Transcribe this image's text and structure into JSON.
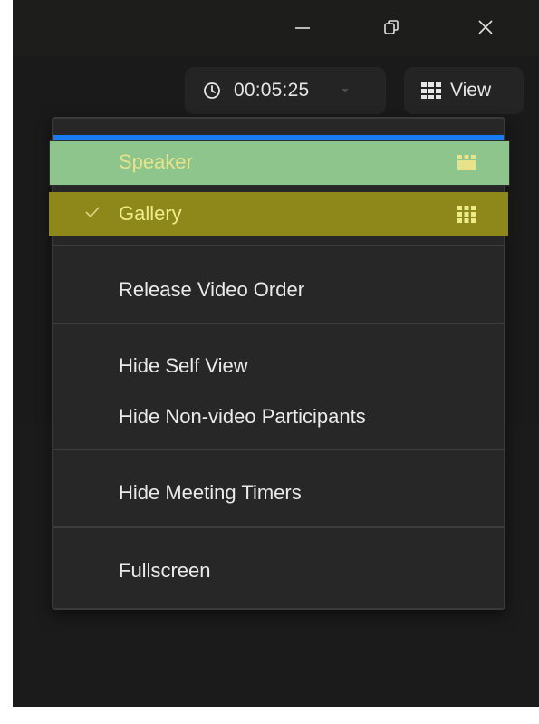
{
  "window": {
    "controls": {
      "minimize_icon": "minimize-icon",
      "restore_icon": "restore-icon",
      "close_icon": "close-icon"
    }
  },
  "toolbar": {
    "timer": {
      "icon": "clock-icon",
      "value": "00:05:25",
      "dropdown_icon": "chevron-down-icon"
    },
    "view": {
      "icon": "grid-icon",
      "label": "View"
    }
  },
  "view_menu": {
    "layouts": [
      {
        "label": "Speaker",
        "checked": false,
        "icon": "speaker-layout-icon",
        "highlight": "#8dc58c"
      },
      {
        "label": "Gallery",
        "checked": true,
        "icon": "gallery-layout-icon",
        "highlight": "#8e871a"
      }
    ],
    "items": {
      "release_video_order": "Release Video Order",
      "hide_self_view": "Hide Self View",
      "hide_non_video": "Hide Non-video Participants",
      "hide_meeting_timers": "Hide Meeting Timers",
      "fullscreen": "Fullscreen"
    }
  },
  "colors": {
    "accent": "#1a7cf5",
    "menu_background": "#272727",
    "window_background": "#1a1a1a"
  }
}
